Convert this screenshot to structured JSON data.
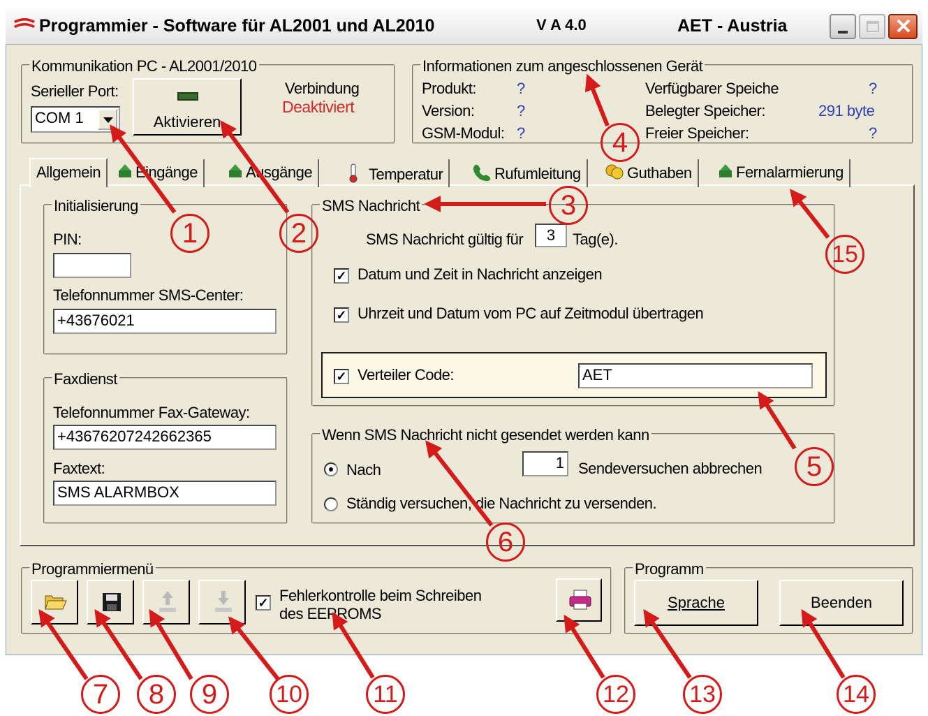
{
  "window": {
    "title": "Programmier - Software für AL2001 und AL2010",
    "version": "V A 4.0",
    "company": "AET - Austria"
  },
  "kommunikation": {
    "legend": "Kommunikation PC - AL2001/2010",
    "port_label": "Serieller Port:",
    "port_value": "COM 1",
    "activate_label": "Aktivieren",
    "connection_label": "Verbindung",
    "connection_status": "Deaktiviert",
    "status_color": "#d52a2a"
  },
  "info": {
    "legend": "Informationen zum angeschlossenen Gerät",
    "produkt_label": "Produkt:",
    "produkt_value": "?",
    "version_label": "Version:",
    "version_value": "?",
    "gsm_label": "GSM-Modul:",
    "gsm_value": "?",
    "avail_label": "Verfügbarer Speiche",
    "avail_value": "?",
    "used_label": "Belegter Speicher:",
    "used_value": "291 byte",
    "free_label": "Freier Speicher:",
    "free_value": "?"
  },
  "tabs": [
    {
      "label": "Allgemein",
      "icon": "none"
    },
    {
      "label": "Eingänge",
      "icon": "arrow-icon"
    },
    {
      "label": "Ausgänge",
      "icon": "arrow-icon"
    },
    {
      "label": "Temperatur",
      "icon": "thermometer-icon"
    },
    {
      "label": "Rufumleitung",
      "icon": "phone-icon"
    },
    {
      "label": "Guthaben",
      "icon": "coins-icon"
    },
    {
      "label": "Fernalarmierung",
      "icon": "arrow-icon"
    }
  ],
  "init": {
    "legend": "Initialisierung",
    "pin_label": "PIN:",
    "pin_value": "",
    "smsc_label": "Telefonnummer SMS-Center:",
    "smsc_value": "+43676021"
  },
  "fax": {
    "legend": "Faxdienst",
    "gateway_label": "Telefonnummer Fax-Gateway:",
    "gateway_value": "+43676207242662365",
    "text_label": "Faxtext:",
    "text_value": "SMS ALARMBOX"
  },
  "sms": {
    "legend": "SMS Nachricht",
    "valid_prefix": "SMS Nachricht gültig für",
    "valid_value": "3",
    "valid_suffix": "Tag(e).",
    "datetime_label": "Datum und Zeit in Nachricht anzeigen",
    "sync_label": "Uhrzeit und Datum vom PC auf Zeitmodul übertragen",
    "verteiler_label": "Verteiler Code:",
    "verteiler_value": "AET",
    "check_mark": "✓"
  },
  "fail": {
    "legend": "Wenn SMS Nachricht nicht gesendet werden kann",
    "nach_label": "Nach",
    "retries_value": "1",
    "retries_suffix": "Sendeversuchen abbrechen",
    "always_label": "Ständig versuchen, die Nachricht zu versenden."
  },
  "progmenu": {
    "legend": "Programmiermenü",
    "errcheck_line1": "Fehlerkontrolle beim Schreiben",
    "errcheck_line2": "des EEPROMS"
  },
  "program": {
    "legend": "Programm",
    "sprache_label": "Sprache",
    "beenden_label": "Beenden"
  },
  "callouts": [
    "1",
    "2",
    "3",
    "4",
    "5",
    "6",
    "7",
    "8",
    "9",
    "10",
    "11",
    "12",
    "13",
    "14",
    "15"
  ],
  "colors": {
    "annotation": "#d51a1a",
    "value_blue": "#2f3fb6",
    "window_bg": "#ece9d8"
  }
}
